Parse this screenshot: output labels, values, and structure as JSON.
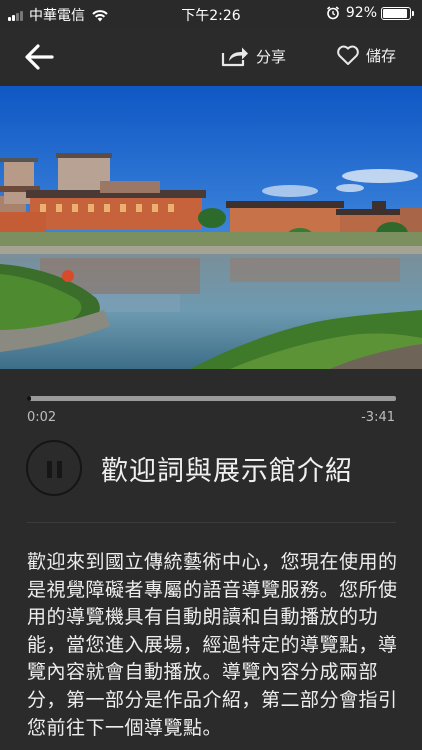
{
  "status_bar": {
    "carrier": "中華電信",
    "time": "下午2:26",
    "battery": "92%",
    "battery_level": 0.92
  },
  "nav": {
    "share_label": "分享",
    "save_label": "儲存"
  },
  "player": {
    "elapsed": "0:02",
    "remaining": "-3:41",
    "progress": 0.01,
    "title": "歡迎詞與展示館介紹"
  },
  "description": "歡迎來到國立傳統藝術中心，您現在使用的是視覺障礙者專屬的語音導覽服務。您所使用的導覽機具有自動朗讀和自動播放的功能，當您進入展場，經過特定的導覽點，導覽內容就會自動播放。導覽內容分成兩部分，第一部分是作品介紹，第二部分會指引您前往下一個導覽點。"
}
